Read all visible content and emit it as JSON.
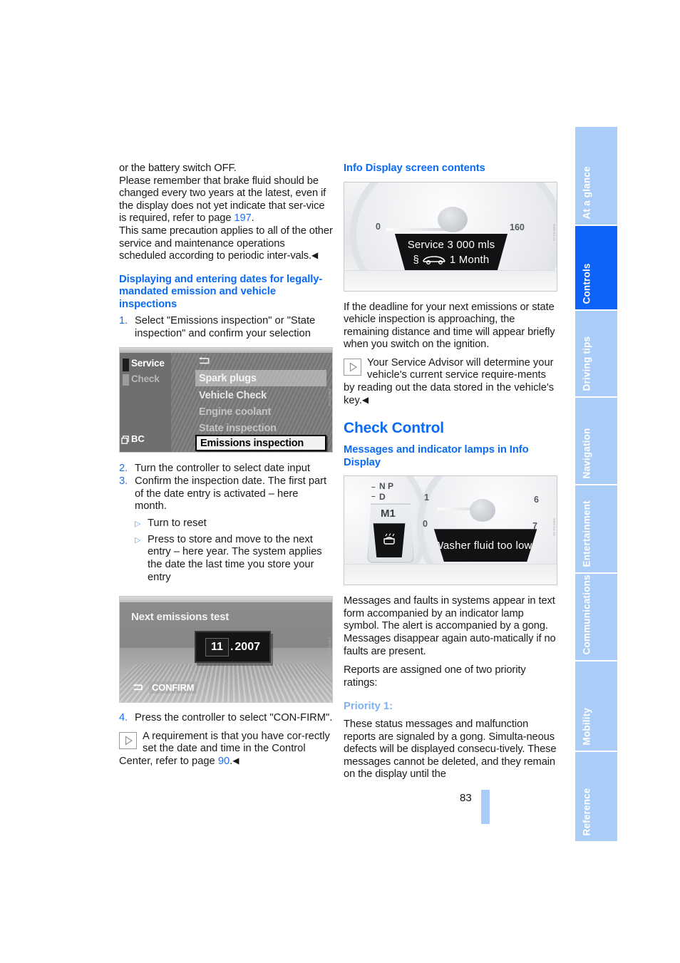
{
  "page": {
    "number": "83"
  },
  "sidebar": {
    "tabs": [
      {
        "label": "At a glance",
        "active": false
      },
      {
        "label": "Controls",
        "active": true
      },
      {
        "label": "Driving tips",
        "active": false
      },
      {
        "label": "Navigation",
        "active": false
      },
      {
        "label": "Entertainment",
        "active": false
      },
      {
        "label": "Communications",
        "active": false
      },
      {
        "label": "Mobility",
        "active": false
      },
      {
        "label": "Reference",
        "active": false
      }
    ],
    "active_color": "#0d63f8",
    "inactive_color": "#aacdf7"
  },
  "left_column": {
    "intro_line": "or the battery switch OFF.",
    "brake_fluid_para_1": "Please remember that brake fluid should be changed every two years at the latest, even if the display does not yet indicate that ser-vice is required, refer to page ",
    "brake_fluid_pageref": "197",
    "brake_fluid_para_1_end": ".",
    "brake_fluid_para_2": "This same precaution applies to all of the other service and maintenance operations scheduled according to periodic inter-vals.",
    "heading": "Displaying and entering dates for legally-mandated emission and vehicle inspections",
    "steps": [
      {
        "num": "1.",
        "text": "Select \"Emissions inspection\" or \"State inspection\" and confirm your selection"
      },
      {
        "num": "2.",
        "text": "Turn the controller to select date input"
      },
      {
        "num": "3.",
        "text": "Confirm the inspection date. The first part of the date entry is activated – here month."
      },
      {
        "num": "4.",
        "text": "Press the controller to select \"CON-FIRM\"."
      }
    ],
    "bullets": [
      "Turn to reset",
      "Press to store and move to the next entry – here year. The system applies the date the last time you store your entry"
    ],
    "note": {
      "text_start": "A requirement is that you have cor-rectly set the date and time in the Control Center, refer to page ",
      "pageref": "90",
      "text_end": "."
    }
  },
  "figures": {
    "idrive_menu": {
      "left_items": [
        "Service",
        "Check"
      ],
      "bottom_item": "BC",
      "menu_items": [
        {
          "label": "Spark plugs",
          "state": "highlighted"
        },
        {
          "label": "Vehicle Check",
          "state": "normal"
        },
        {
          "label": "Engine coolant",
          "state": "normal"
        },
        {
          "label": "State inspection",
          "state": "faded"
        },
        {
          "label": "Emissions inspection",
          "state": "selected"
        }
      ],
      "back_icon": "back-arrow-icon",
      "bc_icon": "bc-panels-icon"
    },
    "emissions_test": {
      "title": "Next emissions test",
      "month": "11",
      "separator": ".",
      "year": "2007",
      "confirm_label": "CONFIRM",
      "back_icon": "back-arrow-icon"
    },
    "info_display": {
      "lcd_line_1": "Service 3 000 mls",
      "lcd_line_2_symbol": "§",
      "lcd_line_2_icon": "car-silhouette-icon",
      "lcd_line_2": "1 Month",
      "tick_low": "0",
      "tick_high": "160"
    },
    "check_control_display": {
      "message": "Washer fluid too low!",
      "gear_letters_top": "N   P",
      "gear_letters_bottom": "D",
      "gear_mode": "M1",
      "indicator_icon": "washer-fluid-icon",
      "tach_low": "0",
      "tach_marks": [
        "1",
        "6",
        "7"
      ]
    }
  },
  "right_column": {
    "info_display_heading": "Info Display screen contents",
    "deadline_para": "If the deadline for your next emissions or state vehicle inspection is approaching, the remaining distance and time will appear briefly when you switch on the ignition.",
    "service_advisor_note": "Your Service Advisor will determine your vehicle's current service require-ments by reading out the data stored in the vehicle's key.",
    "check_control_heading": "Check Control",
    "messages_heading": "Messages and indicator lamps in Info Display",
    "messages_para": "Messages and faults in systems appear in text form accompanied by an indicator lamp symbol. The alert is accompanied by a gong. Messages disappear again auto-matically if no faults are present.",
    "reports_para": "Reports are assigned one of two priority ratings:",
    "priority_heading": "Priority 1:",
    "priority_para": "These status messages and malfunction reports are signaled by a gong. Simulta-neous defects will be displayed consecu-tively. These messages cannot be deleted, and they remain on the display until the"
  }
}
